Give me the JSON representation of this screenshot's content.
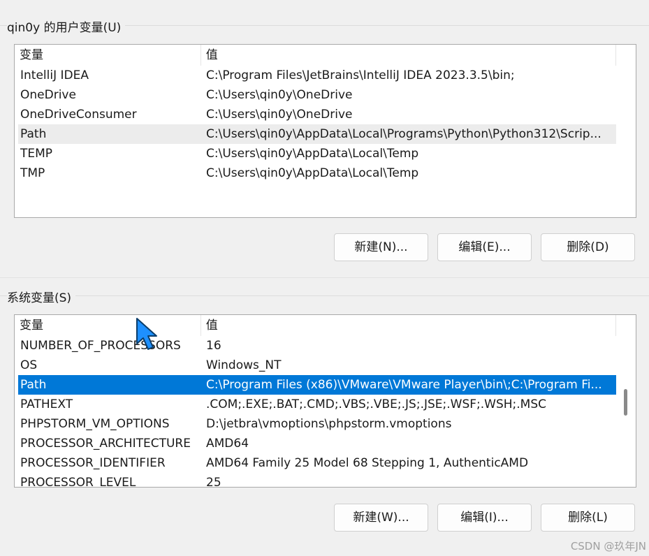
{
  "user_section": {
    "title": "qin0y 的用户变量(U)",
    "columns": [
      "变量",
      "值"
    ],
    "rows": [
      {
        "name": "IntelliJ IDEA",
        "value": "C:\\Program Files\\JetBrains\\IntelliJ IDEA 2023.3.5\\bin;"
      },
      {
        "name": "OneDrive",
        "value": "C:\\Users\\qin0y\\OneDrive"
      },
      {
        "name": "OneDriveConsumer",
        "value": "C:\\Users\\qin0y\\OneDrive"
      },
      {
        "name": "Path",
        "value": "C:\\Users\\qin0y\\AppData\\Local\\Programs\\Python\\Python312\\Scrip..."
      },
      {
        "name": "TEMP",
        "value": "C:\\Users\\qin0y\\AppData\\Local\\Temp"
      },
      {
        "name": "TMP",
        "value": "C:\\Users\\qin0y\\AppData\\Local\\Temp"
      }
    ],
    "buttons": {
      "new": "新建(N)...",
      "edit": "编辑(E)...",
      "delete": "删除(D)"
    }
  },
  "system_section": {
    "title": "系统变量(S)",
    "columns": [
      "变量",
      "值"
    ],
    "rows": [
      {
        "name": "NUMBER_OF_PROCESSORS",
        "value": "16"
      },
      {
        "name": "OS",
        "value": "Windows_NT"
      },
      {
        "name": "Path",
        "value": "C:\\Program Files (x86)\\VMware\\VMware Player\\bin\\;C:\\Program Fi..."
      },
      {
        "name": "PATHEXT",
        "value": ".COM;.EXE;.BAT;.CMD;.VBS;.VBE;.JS;.JSE;.WSF;.WSH;.MSC"
      },
      {
        "name": "PHPSTORM_VM_OPTIONS",
        "value": "D:\\jetbra\\vmoptions\\phpstorm.vmoptions"
      },
      {
        "name": "PROCESSOR_ARCHITECTURE",
        "value": "AMD64"
      },
      {
        "name": "PROCESSOR_IDENTIFIER",
        "value": "AMD64 Family 25 Model 68 Stepping 1, AuthenticAMD"
      },
      {
        "name": "PROCESSOR_LEVEL",
        "value": "25"
      }
    ],
    "buttons": {
      "new": "新建(W)...",
      "edit": "编辑(I)...",
      "delete": "删除(L)"
    }
  },
  "watermark": "CSDN @玖年JN",
  "colors": {
    "selection": "#0078d7",
    "hover": "#ececec",
    "cursor": "#1e90ff"
  }
}
